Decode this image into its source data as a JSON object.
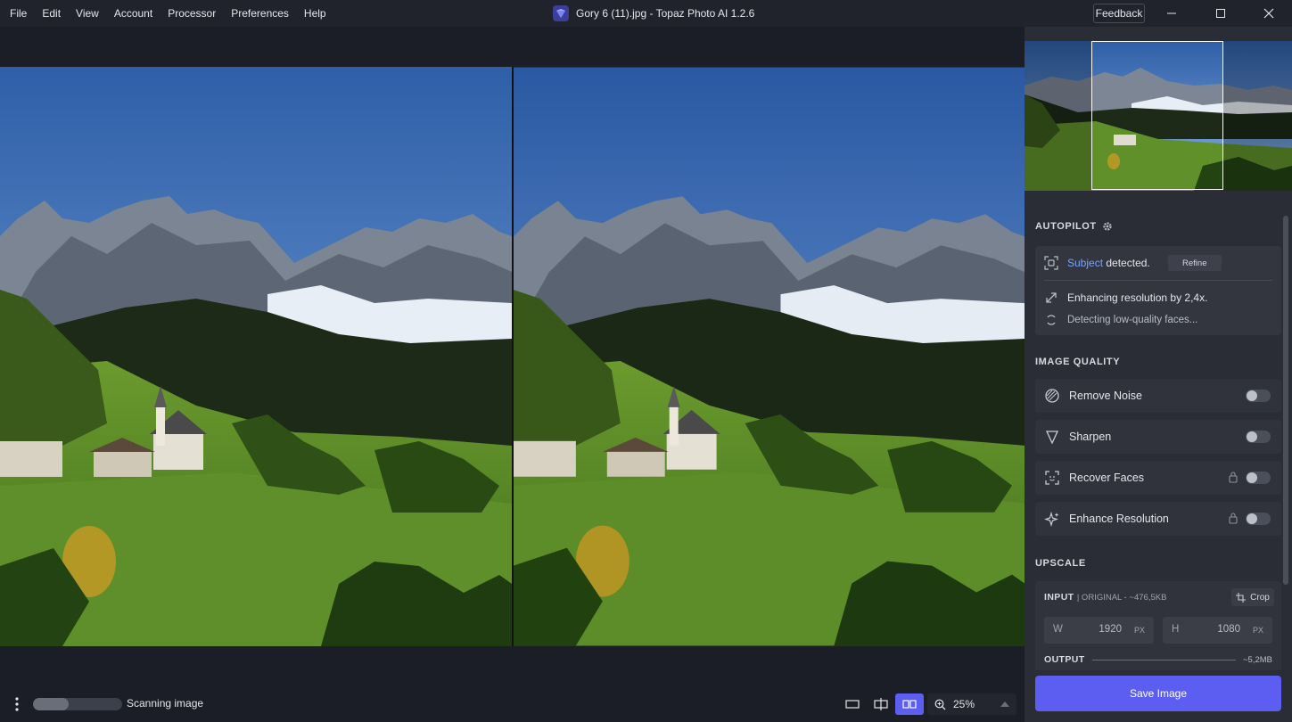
{
  "menu": [
    "File",
    "Edit",
    "View",
    "Account",
    "Processor",
    "Preferences",
    "Help"
  ],
  "app_title": "Gory 6 (11).jpg - Topaz Photo AI 1.2.6",
  "feedback_label": "Feedback",
  "autopilot": {
    "title": "AUTOPILOT",
    "subject_word": "Subject",
    "subject_rest": "detected.",
    "refine_label": "Refine",
    "enhancing_text": "Enhancing resolution by 2,4x.",
    "detecting_text": "Detecting low-quality faces..."
  },
  "image_quality": {
    "title": "IMAGE QUALITY",
    "items": [
      {
        "label": "Remove Noise",
        "icon": "remove-noise-icon",
        "locked": false,
        "enabled": false
      },
      {
        "label": "Sharpen",
        "icon": "sharpen-icon",
        "locked": false,
        "enabled": false
      },
      {
        "label": "Recover Faces",
        "icon": "recover-faces-icon",
        "locked": true,
        "enabled": false
      },
      {
        "label": "Enhance Resolution",
        "icon": "enhance-resolution-icon",
        "locked": true,
        "enabled": false
      }
    ]
  },
  "upscale": {
    "title": "UPSCALE",
    "input_label": "INPUT",
    "input_sub": "| ORIGINAL - ~476,5KB",
    "crop_label": "Crop",
    "width_label": "W",
    "width_value": "1920",
    "height_label": "H",
    "height_value": "1080",
    "unit": "PX",
    "output_label": "OUTPUT",
    "output_size": "~5,2MB"
  },
  "save_label": "Save Image",
  "status": {
    "text": "Scanning image",
    "progress_fraction": 0.4
  },
  "zoom": {
    "value": "25%"
  },
  "colors": {
    "accent": "#5b5ef0",
    "link": "#7aa2ff",
    "panel_bg": "#2a2d35",
    "canvas_bg": "#1b1e26"
  }
}
